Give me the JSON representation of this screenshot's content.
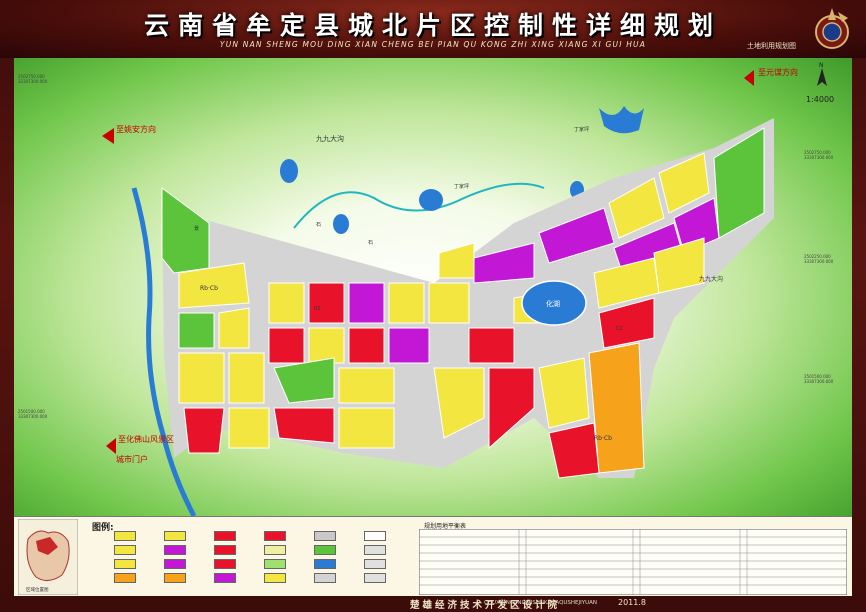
{
  "header": {
    "title": "云南省牟定县城北片区控制性详细规划",
    "subtitle": "YUN NAN SHENG  MOU DING XIAN CHENG BEI PIAN QU KONG ZHI XING XIANG XI GUI HUA",
    "sheet": "土地利用规划图"
  },
  "map": {
    "scale": "1:4000",
    "north": "N",
    "directions": {
      "to_yaoan": "至姚安方向",
      "to_yuanmou": "至元谋方向",
      "to_huahua": "至化佛山风景区",
      "to_gate": "城市门户"
    },
    "places": {
      "jiujiu_ditch": "九九大沟",
      "jiujiu_ditch_east": "九九大沟",
      "dingjia": "丁家坪",
      "dingjia2": "丁家坪",
      "lake": "化湖",
      "park": "景",
      "shiqiao": "石",
      "shi2": "石"
    },
    "codes": {
      "big1": "Rb·Cb",
      "big2": "Rb·Cb",
      "r2": "R2",
      "c2": "C2"
    },
    "coords": {
      "tl": "2502750.000",
      "tl2": "33307300.000",
      "tr": "2502750.000",
      "tr2": "33307300.000",
      "ml": "2501500.000",
      "ml2": "33307300.000",
      "mr": "2501500.000",
      "mr2": "33307300.000",
      "rr": "2502250.000",
      "rr2": "33307300.000"
    }
  },
  "legend": {
    "title": "图例:",
    "location_caption": "区域位置图",
    "balance_title": "规划用地平衡表"
  },
  "footer": {
    "org": "楚雄经济技术开发区设计院",
    "pinyin": "CHUXIONGJINGJIJISHUKAIFAQUSHEJIYUAN",
    "date": "2011.8"
  },
  "colors": {
    "residential": "#f4e640",
    "commercial": "#e8132a",
    "cultural": "#c218d6",
    "education": "#f6a21a",
    "green": "#5cc43a",
    "water": "#2a7bd4",
    "road": "#c8c8c8",
    "admin": "#f0eea0"
  }
}
